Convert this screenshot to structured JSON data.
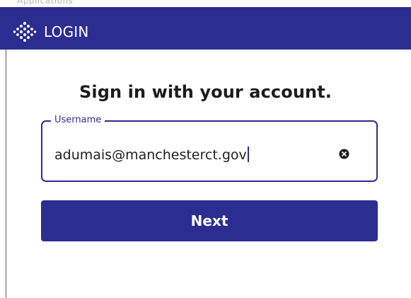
{
  "header": {
    "title": "LOGIN",
    "background_color": "#2b2d91",
    "logo_icon": "diamond-dots-logo-icon",
    "clipped_top_text": "Applications"
  },
  "signin": {
    "heading": "Sign in with your account.",
    "username_field": {
      "label": "Username",
      "value": "adumais@manchesterct.gov",
      "clear_icon": "close-circle-icon",
      "focused": true
    },
    "next_button": {
      "label": "Next"
    }
  },
  "colors": {
    "accent": "#2b2d91",
    "text": "#1c1c1c",
    "background": "#ffffff"
  }
}
